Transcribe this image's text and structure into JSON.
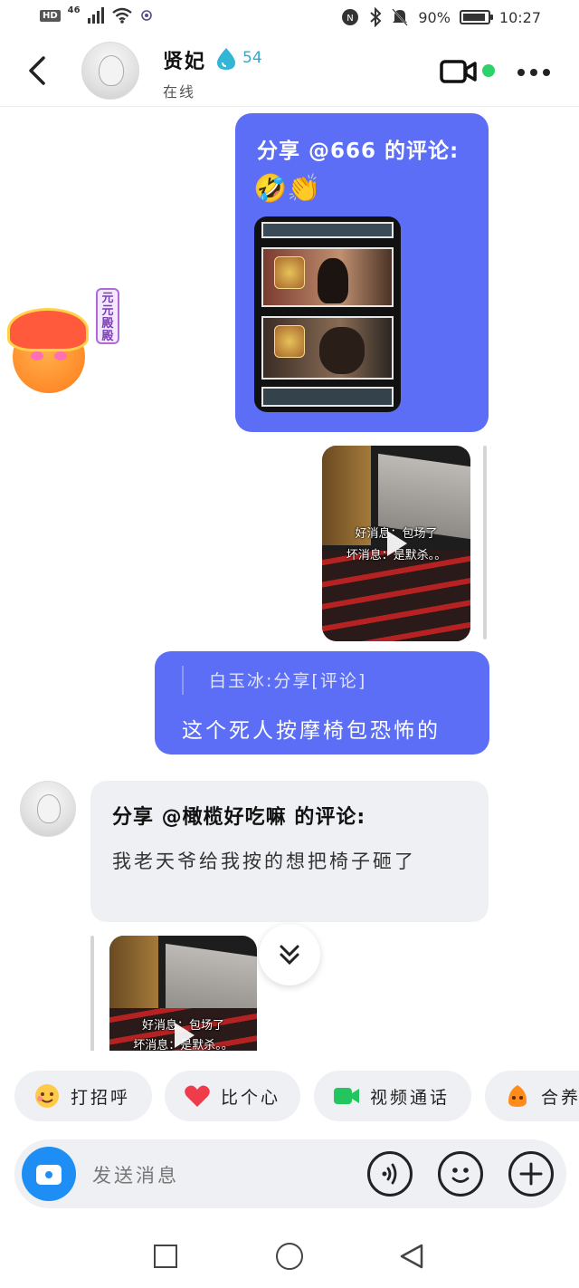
{
  "status_bar": {
    "hd": "HD",
    "network": "46",
    "battery": "90%",
    "time": "10:27"
  },
  "header": {
    "back_icon": "chevron-left-icon",
    "name": "贤妃",
    "streak": "54",
    "status": "在线",
    "online_color": "#2bd36a"
  },
  "messages": {
    "share_comment": {
      "title": "分享 @666 的评论:",
      "emoji": "🤣👏"
    },
    "sticker": {
      "tag": "元元殿殿"
    },
    "video_a": {
      "caption_1": "好消息：包场了",
      "caption_2": "坏消息：是默杀。。"
    },
    "reply": {
      "quote": "白玉冰:分享[评论]",
      "text": "这个死人按摩椅包恐怖的"
    },
    "incoming_share": {
      "title": "分享 @橄榄好吃嘛 的评论:",
      "body": "我老天爷给我按的想把椅子砸了"
    },
    "video_b": {
      "caption_1": "好消息：包场了",
      "caption_2": "坏消息：是默杀。。"
    }
  },
  "quick_actions": [
    {
      "label": "打招呼",
      "icon": "wave-emoji-icon"
    },
    {
      "label": "比个心",
      "icon": "heart-icon"
    },
    {
      "label": "视频通话",
      "icon": "video-call-icon"
    },
    {
      "label": "合养",
      "icon": "pet-icon"
    }
  ],
  "input": {
    "placeholder": "发送消息"
  },
  "colors": {
    "accent_blue": "#5b6ef5",
    "camera_blue": "#1e8ef5"
  }
}
